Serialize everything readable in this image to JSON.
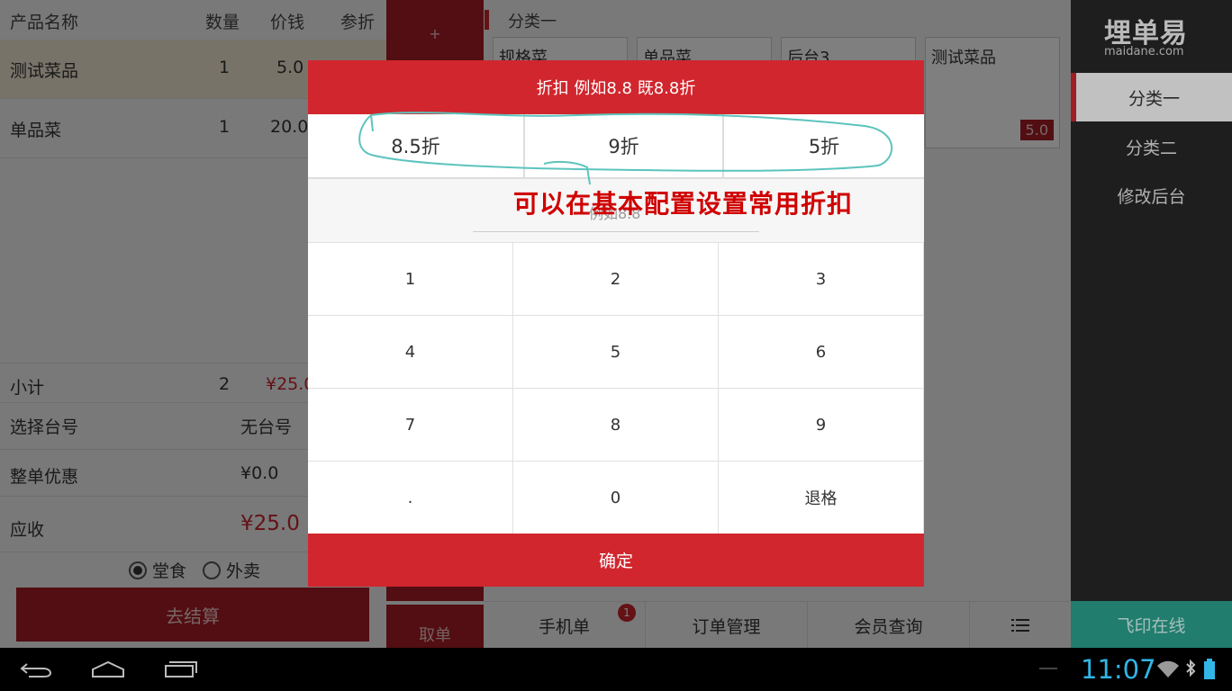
{
  "order": {
    "headers": [
      "产品名称",
      "数量",
      "价钱",
      "参折"
    ],
    "rows": [
      {
        "name": "测试菜品",
        "qty": "1",
        "price": "5.0"
      },
      {
        "name": "单品菜",
        "qty": "1",
        "price": "20.0"
      }
    ],
    "subtotal_label": "小计",
    "subtotal_qty": "2",
    "subtotal_value": "¥25.0",
    "table_label": "选择台号",
    "table_value": "无台号",
    "discount_label": "整单优惠",
    "discount_value": "¥0.0",
    "due_label": "应收",
    "due_value": "¥25.0",
    "dine_in": "堂食",
    "takeout": "外卖",
    "checkout": "去结算"
  },
  "middle": {
    "plus": "+",
    "take_order": "取单"
  },
  "category": {
    "title": "分类一",
    "cards": [
      {
        "name": "规格菜",
        "price": ""
      },
      {
        "name": "单品菜",
        "price": ""
      },
      {
        "name": "后台3",
        "price": ""
      },
      {
        "name": "测试菜品",
        "price": "5.0"
      }
    ]
  },
  "bottom_tabs": {
    "mobile": "手机单",
    "mobile_badge": "1",
    "orders": "订单管理",
    "members": "会员查询"
  },
  "sidebar": {
    "logo": "埋单易",
    "logo_sub": "maidane.com",
    "items": [
      "分类一",
      "分类二",
      "修改后台"
    ],
    "printer": "飞印在线"
  },
  "modal": {
    "title": "折扣 例如8.8 既8.8折",
    "quick": [
      "8.5折",
      "9折",
      "5折"
    ],
    "placeholder": "例如8.8",
    "keys": [
      "1",
      "2",
      "3",
      "4",
      "5",
      "6",
      "7",
      "8",
      "9",
      ".",
      "0",
      "退格"
    ],
    "confirm": "确定"
  },
  "annotation": {
    "text": "可以在基本配置设置常用折扣"
  },
  "status": {
    "time": "11:07"
  },
  "colors": {
    "accent": "#d1262d",
    "dark_red": "#a51d24",
    "teal": "#2a9d8a",
    "clock": "#31b6e7"
  }
}
